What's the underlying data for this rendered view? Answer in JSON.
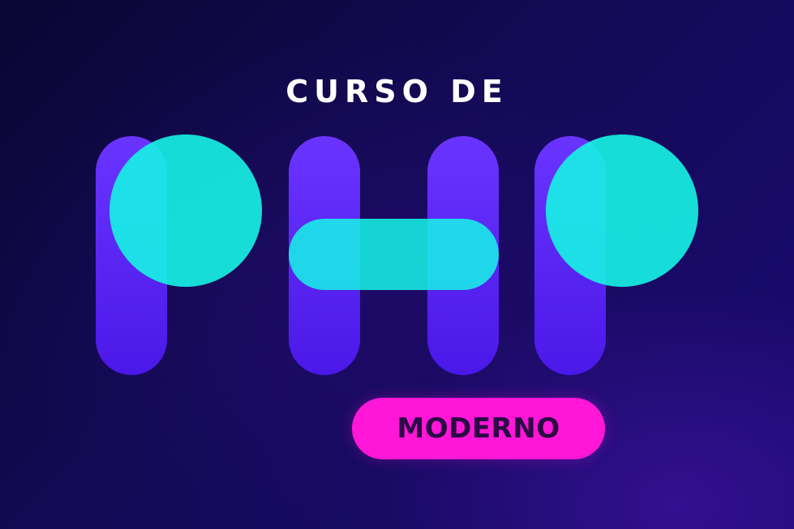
{
  "banner": {
    "title": "CURSO DE",
    "badge_label": "MODERNO",
    "logo_word": "PHP"
  },
  "colors": {
    "background_dark": "#0a0633",
    "background_light": "#1c0a74",
    "bar_purple": "#5b2cf5",
    "shape_cyan": "#16f4e6",
    "badge_magenta": "#ff16d6",
    "badge_text": "#2b0a45",
    "title_text": "#ffffff"
  }
}
